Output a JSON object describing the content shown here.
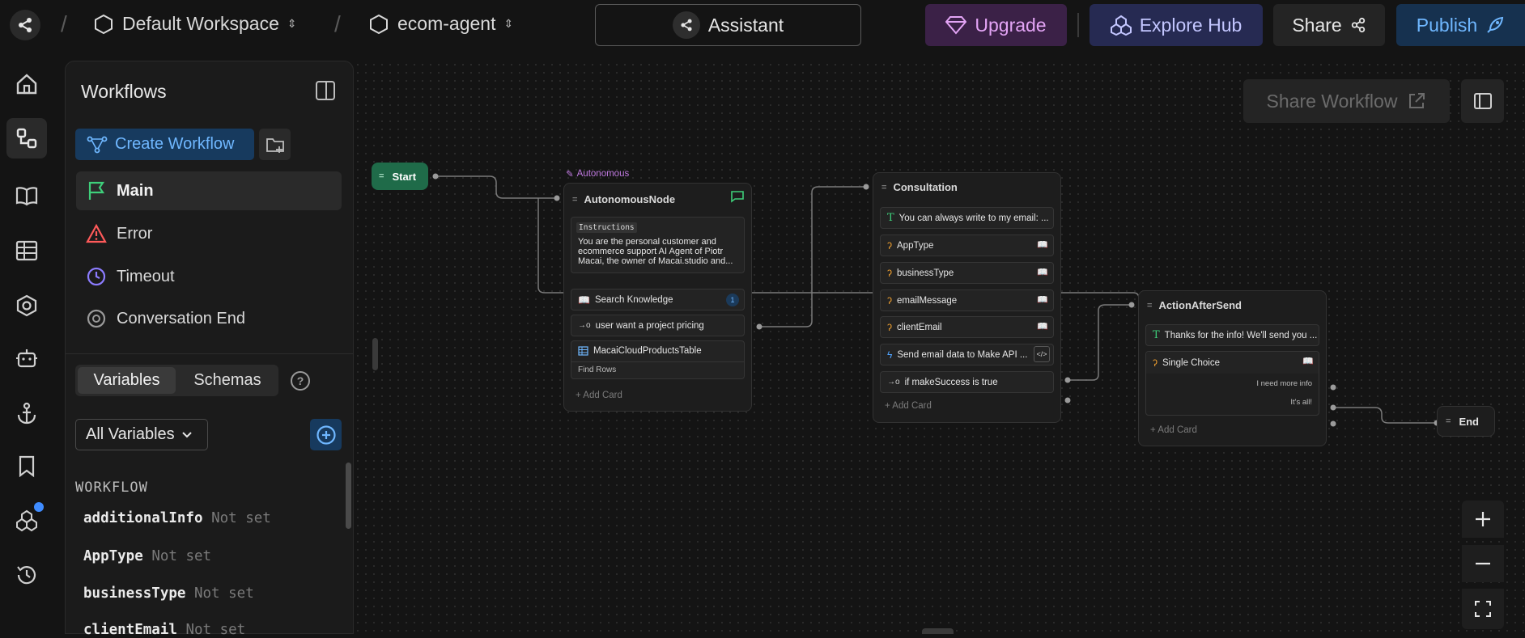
{
  "topbar": {
    "workspace": "Default Workspace",
    "project": "ecom-agent",
    "assistant": "Assistant",
    "upgrade": "Upgrade",
    "explore_hub": "Explore Hub",
    "share": "Share",
    "publish": "Publish"
  },
  "rail": [
    "home-icon",
    "workflows-icon",
    "knowledge-book-icon",
    "table-icon",
    "integrations-icon",
    "agent-bot-icon",
    "anchor-icon",
    "bookmark-icon",
    "hub-icon",
    "history-icon"
  ],
  "sidebar": {
    "title": "Workflows",
    "create_workflow": "Create Workflow",
    "workflows": [
      {
        "label": "Main",
        "icon": "flag-icon"
      },
      {
        "label": "Error",
        "icon": "warning-icon"
      },
      {
        "label": "Timeout",
        "icon": "clock-icon"
      },
      {
        "label": "Conversation End",
        "icon": "end-circle-icon"
      }
    ],
    "tabs": {
      "variables": "Variables",
      "schemas": "Schemas"
    },
    "filter": "All Variables",
    "section": "WORKFLOW",
    "variables": [
      {
        "name": "additionalInfo",
        "value": "Not set"
      },
      {
        "name": "AppType",
        "value": "Not set"
      },
      {
        "name": "businessType",
        "value": "Not set"
      },
      {
        "name": "clientEmail",
        "value": "Not set"
      }
    ]
  },
  "canvas": {
    "share_workflow": "Share Workflow",
    "start": "Start",
    "end": "End",
    "autonomous_tag": "Autonomous",
    "autonomous_node": {
      "title": "AutonomousNode",
      "instructions_label": "Instructions",
      "instructions": "You are the personal customer and ecommerce support AI Agent of Piotr Macai, the owner of Macai.studio and...",
      "search_knowledge": "Search Knowledge",
      "search_count": "1",
      "pricing": "user want a project pricing",
      "table": "MacaiCloudProductsTable",
      "find_rows": "Find Rows",
      "add_card": "Add Card"
    },
    "consultation_node": {
      "title": "Consultation",
      "cards": [
        "You can always write to my email: ...",
        "AppType",
        "businessType",
        "emailMessage",
        "clientEmail",
        "Send email data to Make API ...",
        "if makeSuccess is true"
      ],
      "add_card": "Add Card"
    },
    "action_node": {
      "title": "ActionAfterSend",
      "text_card": "Thanks for the info! We'll send you ...",
      "choice": "Single Choice",
      "option1": "I need more info",
      "option2": "It's all!",
      "add_card": "Add Card"
    }
  },
  "colors": {
    "start_green": "#1f6b49",
    "upgrade_purple": "#3b2147",
    "explore_blue": "#262a52",
    "publish_blue": "#16314f",
    "accent_blue": "#4fa3ff"
  }
}
